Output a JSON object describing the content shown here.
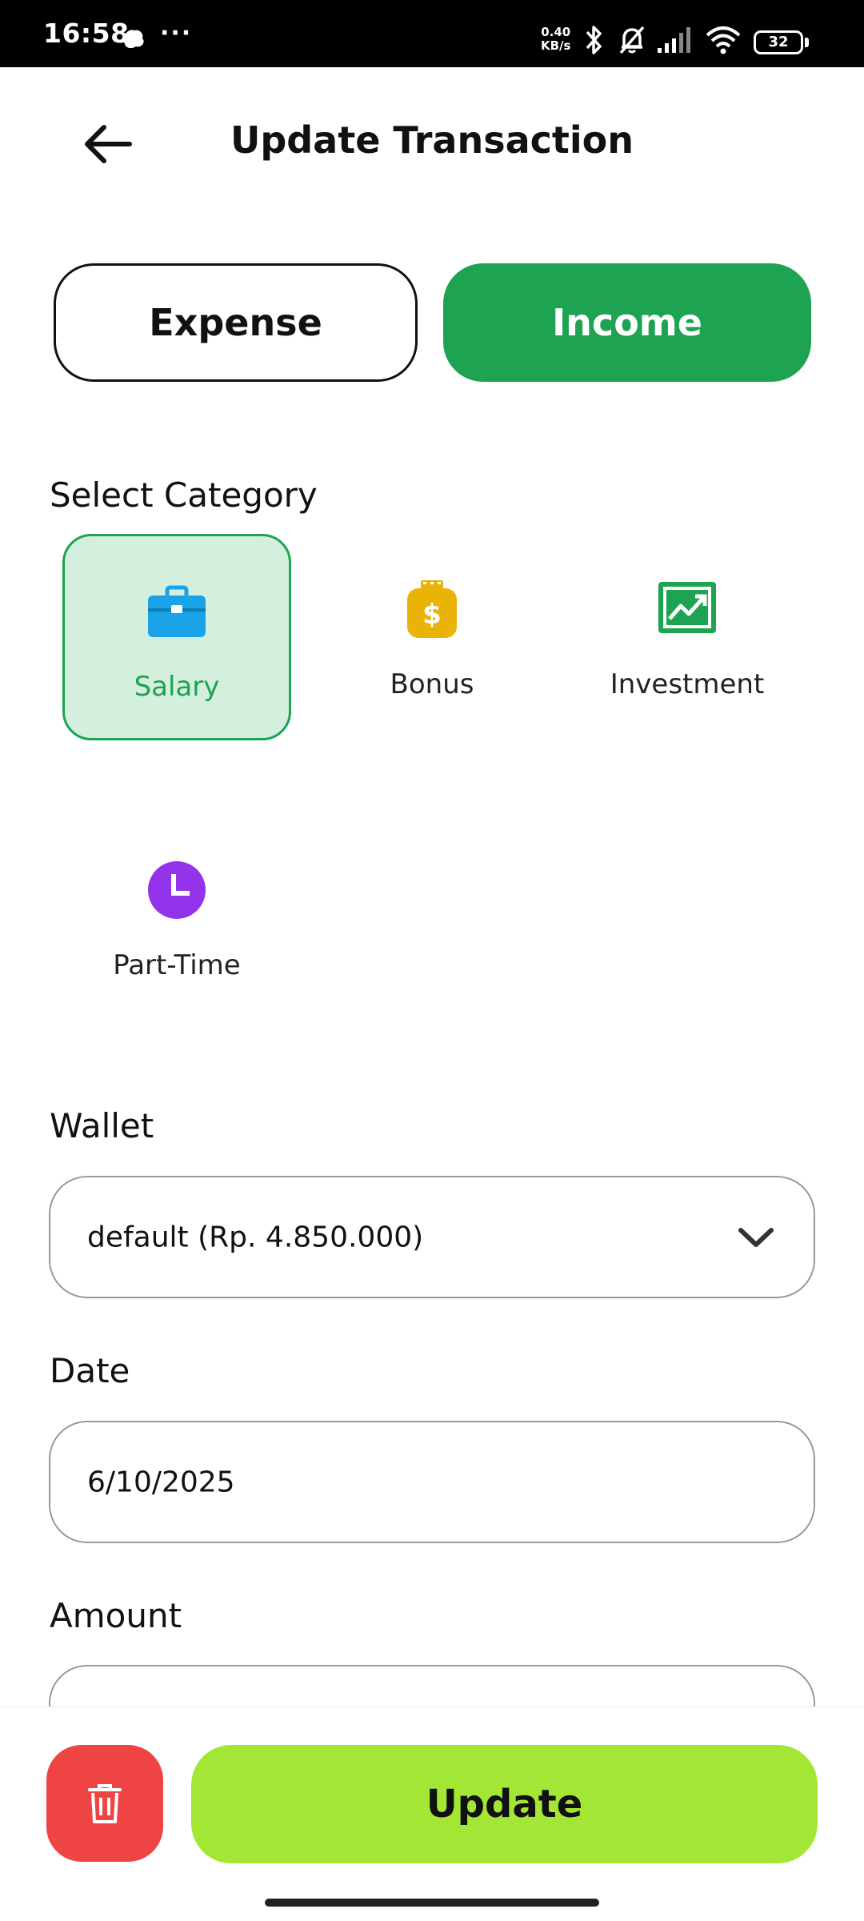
{
  "status_bar": {
    "time": "16:58",
    "more": "···",
    "speed_value": "0.40",
    "speed_unit": "KB/s",
    "battery": "32",
    "icons": [
      "app-notification-icon",
      "bluetooth-icon",
      "bell-muted-icon",
      "signal-icon",
      "wifi-icon",
      "battery-icon"
    ]
  },
  "header": {
    "title": "Update Transaction",
    "back_icon": "arrow-left-icon"
  },
  "type_toggle": {
    "expense_label": "Expense",
    "income_label": "Income",
    "selected": "Income"
  },
  "category": {
    "section_label": "Select Category",
    "items": [
      {
        "label": "Salary",
        "icon": "briefcase-icon",
        "color": "#1aa3e8",
        "selected": true
      },
      {
        "label": "Bonus",
        "icon": "money-bag-icon",
        "color": "#eab308",
        "selected": false
      },
      {
        "label": "Investment",
        "icon": "chart-line-icon",
        "color": "#1da351",
        "selected": false
      },
      {
        "label": "Part-Time",
        "icon": "clock-icon",
        "color": "#9333ea",
        "selected": false
      }
    ]
  },
  "wallet": {
    "label": "Wallet",
    "value": "default (Rp. 4.850.000)"
  },
  "date": {
    "label": "Date",
    "value": "6/10/2025"
  },
  "amount": {
    "label": "Amount"
  },
  "actions": {
    "update_label": "Update",
    "delete_icon": "trash-icon"
  },
  "colors": {
    "primary_green": "#1da351",
    "selected_tile_bg": "#d4efdd",
    "update_lime": "#a3e635",
    "delete_red": "#ef4444"
  }
}
